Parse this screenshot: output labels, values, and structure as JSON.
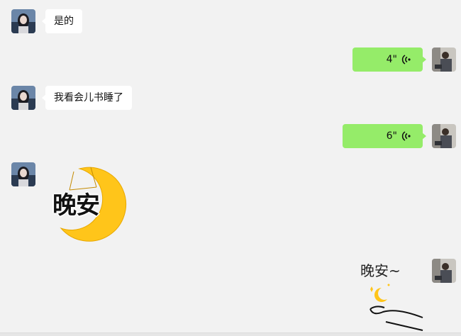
{
  "messages": [
    {
      "from": "other",
      "type": "text",
      "text": "是的"
    },
    {
      "from": "self",
      "type": "voice",
      "duration": "4\""
    },
    {
      "from": "other",
      "type": "text",
      "text": "我看会儿书睡了"
    },
    {
      "from": "self",
      "type": "voice",
      "duration": "6\""
    },
    {
      "from": "other",
      "type": "sticker",
      "text": "晚安"
    },
    {
      "from": "self",
      "type": "sticker",
      "text": "晚安~"
    }
  ],
  "colors": {
    "background": "#f2f2f2",
    "self_bubble": "#95ec69",
    "other_bubble": "#ffffff",
    "moon": "#ffc51a"
  },
  "icons": {
    "voice": "voice-wave-icon",
    "moon": "crescent-moon-icon"
  }
}
